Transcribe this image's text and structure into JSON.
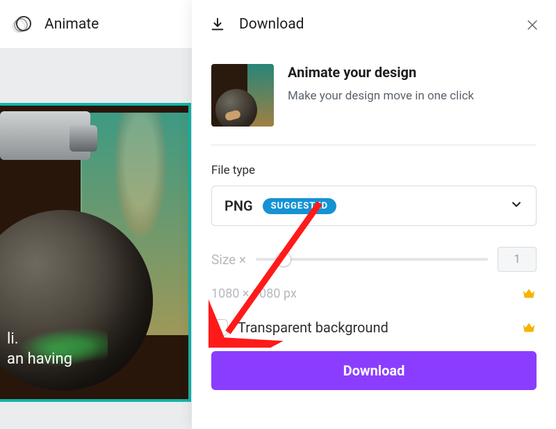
{
  "topbar": {
    "animate_label": "Animate"
  },
  "canvas": {
    "caption_line1": "li.",
    "caption_line2": "an having"
  },
  "panel": {
    "title": "Download",
    "promo_title": "Animate your design",
    "promo_subtitle": "Make your design move in one click",
    "file_type_label": "File type",
    "file_type_value": "PNG",
    "file_type_badge": "SUGGESTED",
    "size_label": "Size ×",
    "size_value": "1",
    "dimensions_text": "1080 × 1080 px",
    "transparent_label": "Transparent background",
    "download_button": "Download"
  }
}
